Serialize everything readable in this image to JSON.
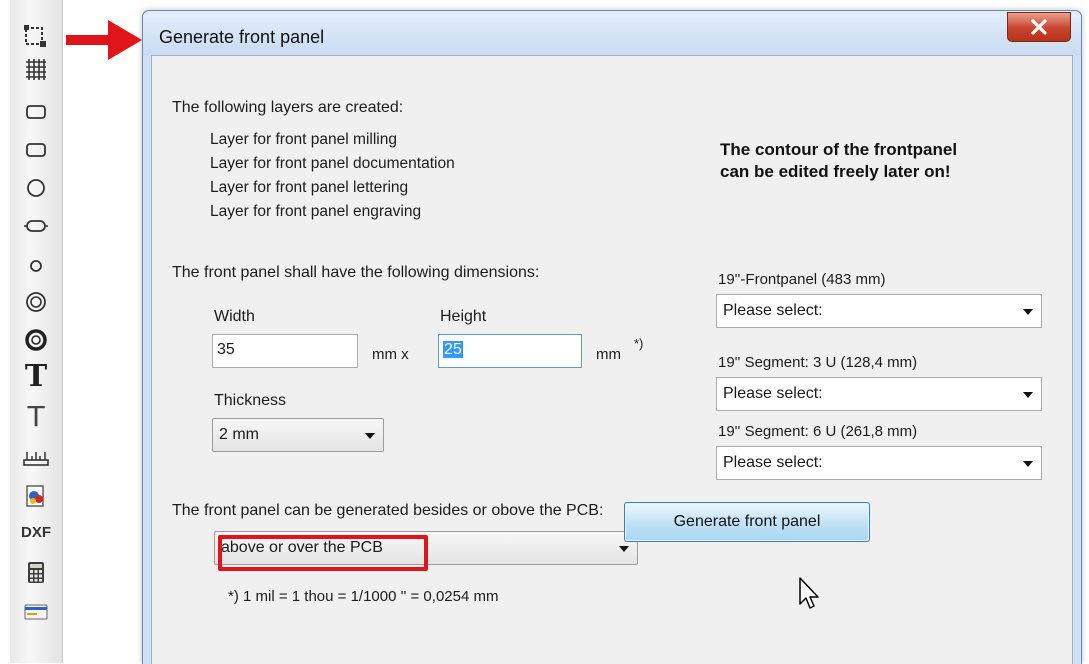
{
  "toolbar": {
    "items": [
      {
        "icon": "frame-select-icon"
      },
      {
        "icon": "grid-icon"
      },
      {
        "icon": "rounded-rect-icon"
      },
      {
        "icon": "rounded-rect-2-icon"
      },
      {
        "icon": "circle-icon"
      },
      {
        "icon": "oval-pad-icon"
      },
      {
        "icon": "small-circle-icon"
      },
      {
        "icon": "ring-icon"
      },
      {
        "icon": "thick-ring-icon"
      },
      {
        "icon": "text-bold-icon",
        "glyph": "T"
      },
      {
        "icon": "text-thin-icon",
        "glyph": "T"
      },
      {
        "icon": "ruler-icon"
      },
      {
        "icon": "image-import-icon"
      },
      {
        "icon": "dxf-import-icon",
        "glyph": "DXF"
      },
      {
        "icon": "calculator-icon"
      },
      {
        "icon": "card-icon"
      }
    ]
  },
  "dialog": {
    "title": "Generate front panel",
    "layers_heading": "The following layers are created:",
    "layers": [
      "Layer for front panel milling",
      "Layer for front panel documentation",
      "Layer for front panel lettering",
      "Layer for front panel engraving"
    ],
    "contour_note_line1": "The contour of the frontpanel",
    "contour_note_line2": "can be edited freely later on!",
    "dimensions_heading": "The front panel shall have the following dimensions:",
    "width_label": "Width",
    "width_value": "35",
    "unit_x": "mm  x",
    "height_label": "Height",
    "height_value": "25",
    "unit_mm": "mm",
    "footnote_mark": "*)",
    "thickness_label": "Thickness",
    "thickness_value": "2 mm",
    "position_heading": "The front panel can be generated besides or obove the PCB:",
    "position_value": "above or over the PCB",
    "footnote_text": "*) 1 mil  =  1 thou  =  1/1000 ''  =  0,0254 mm",
    "rack_19_label": "19''-Frontpanel (483 mm)",
    "rack_19_value": "Please select:",
    "segment_3u_label": "19'' Segment: 3 U (128,4 mm)",
    "segment_3u_value": "Please select:",
    "segment_6u_label": "19'' Segment: 6 U (261,8 mm)",
    "segment_6u_value": "Please select:",
    "generate_button": "Generate front panel"
  },
  "colors": {
    "highlight_red": "#e0141b",
    "selection_blue": "#3399ff",
    "close_button_red": "#c8452d",
    "window_frame": "#cfe0f2"
  }
}
